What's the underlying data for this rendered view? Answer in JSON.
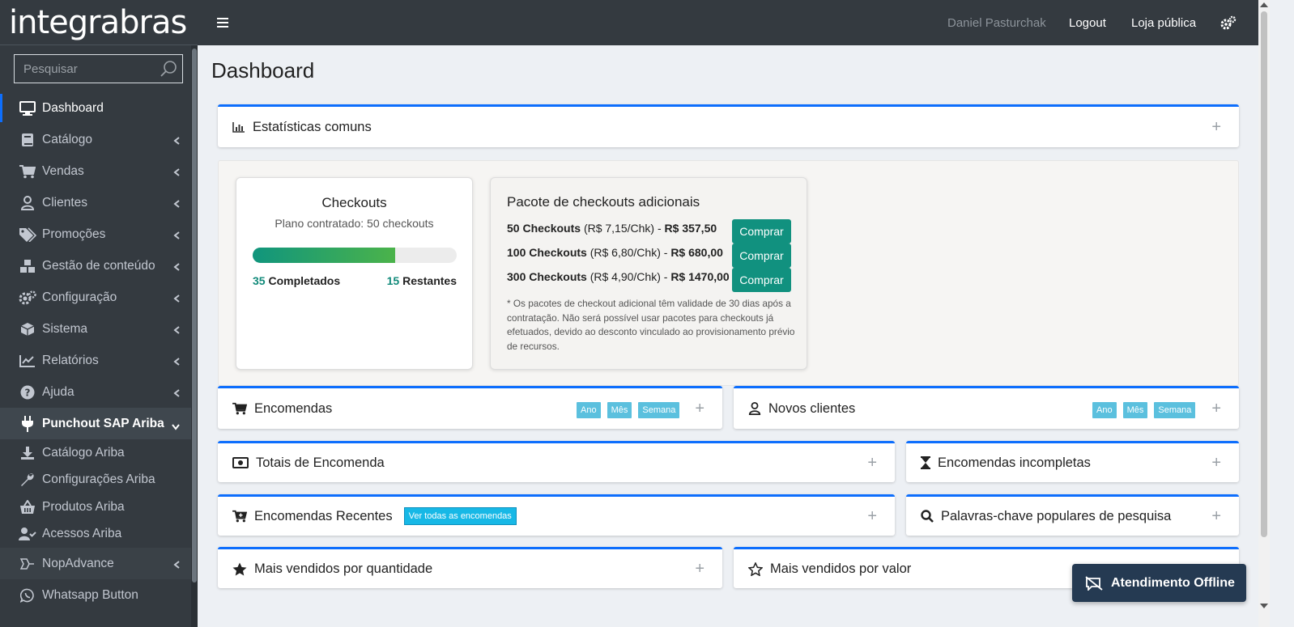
{
  "brand": {
    "logo_text": "integrabras"
  },
  "search": {
    "placeholder": "Pesquisar"
  },
  "sidebar": {
    "items": [
      {
        "label": "Dashboard",
        "icon": "monitor-icon"
      },
      {
        "label": "Catálogo",
        "icon": "book-icon"
      },
      {
        "label": "Vendas",
        "icon": "cart-icon"
      },
      {
        "label": "Clientes",
        "icon": "user-icon"
      },
      {
        "label": "Promoções",
        "icon": "tags-icon"
      },
      {
        "label": "Gestão de conteúdo",
        "icon": "cubes-icon"
      },
      {
        "label": "Configuração",
        "icon": "gears-icon"
      },
      {
        "label": "Sistema",
        "icon": "cube-icon"
      },
      {
        "label": "Relatórios",
        "icon": "chart-line-icon"
      },
      {
        "label": "Ajuda",
        "icon": "question-circle-icon"
      },
      {
        "label": "Punchout SAP Ariba",
        "icon": "plug-icon"
      }
    ],
    "sub_items": [
      {
        "label": "Catálogo Ariba",
        "icon": "download-icon"
      },
      {
        "label": "Configurações Ariba",
        "icon": "wrench-icon"
      },
      {
        "label": "Produtos Ariba",
        "icon": "basket-icon"
      },
      {
        "label": "Acessos Ariba",
        "icon": "user-check-icon"
      }
    ],
    "more_items": [
      {
        "label": "NopAdvance",
        "icon": "nopadvance-icon"
      },
      {
        "label": "Whatsapp Button",
        "icon": "whatsapp-icon"
      }
    ]
  },
  "header": {
    "user": "Daniel Pasturchak",
    "logout": "Logout",
    "store": "Loja pública"
  },
  "page": {
    "title": "Dashboard"
  },
  "stats_card": {
    "title": "Estatísticas comuns"
  },
  "checkouts": {
    "title": "Checkouts",
    "plan": "Plano contratado: 50 checkouts",
    "progress": 0.7,
    "completed_value": "35",
    "completed_label": "Completados",
    "remaining_value": "15",
    "remaining_label": "Restantes"
  },
  "packages": {
    "title": "Pacote de checkouts adicionais",
    "rows": [
      {
        "name": "50 Checkouts",
        "rate": "(R$ 7,15/Chk) -",
        "price": "R$ 357,50",
        "button": "Comprar"
      },
      {
        "name": "100 Checkouts",
        "rate": "(R$ 6,80/Chk) -",
        "price": "R$ 680,00",
        "button": "Comprar"
      },
      {
        "name": "300 Checkouts",
        "rate": "(R$ 4,90/Chk) -",
        "price": "R$ 1470,00",
        "button": "Comprar"
      }
    ],
    "note": "* Os pacotes de checkout adicional têm validade de 30 dias após a contratação. Não será possível usar pacotes para checkouts já efetuados, devido ao desconto vinculado ao provisionamento prévio de recursos."
  },
  "period_pills": [
    "Ano",
    "Mês",
    "Semana"
  ],
  "cards": {
    "orders": "Encomendas",
    "new_customers": "Novos clientes",
    "order_totals": "Totais de Encomenda",
    "incomplete_orders": "Encomendas incompletas",
    "recent_orders": "Encomendas Recentes",
    "recent_orders_link": "Ver todas as encomendas",
    "popular_keywords": "Palavras-chave populares de pesquisa",
    "bestsellers_qty": "Mais vendidos por quantidade",
    "bestsellers_value": "Mais vendidos por valor"
  },
  "plus_symbol": "+",
  "chat": {
    "label": "Atendimento Offline"
  },
  "colors": {
    "accent": "#0d6efd",
    "sidebar": "#343a40",
    "button": "#11917f",
    "pill": "#5bc0de"
  }
}
